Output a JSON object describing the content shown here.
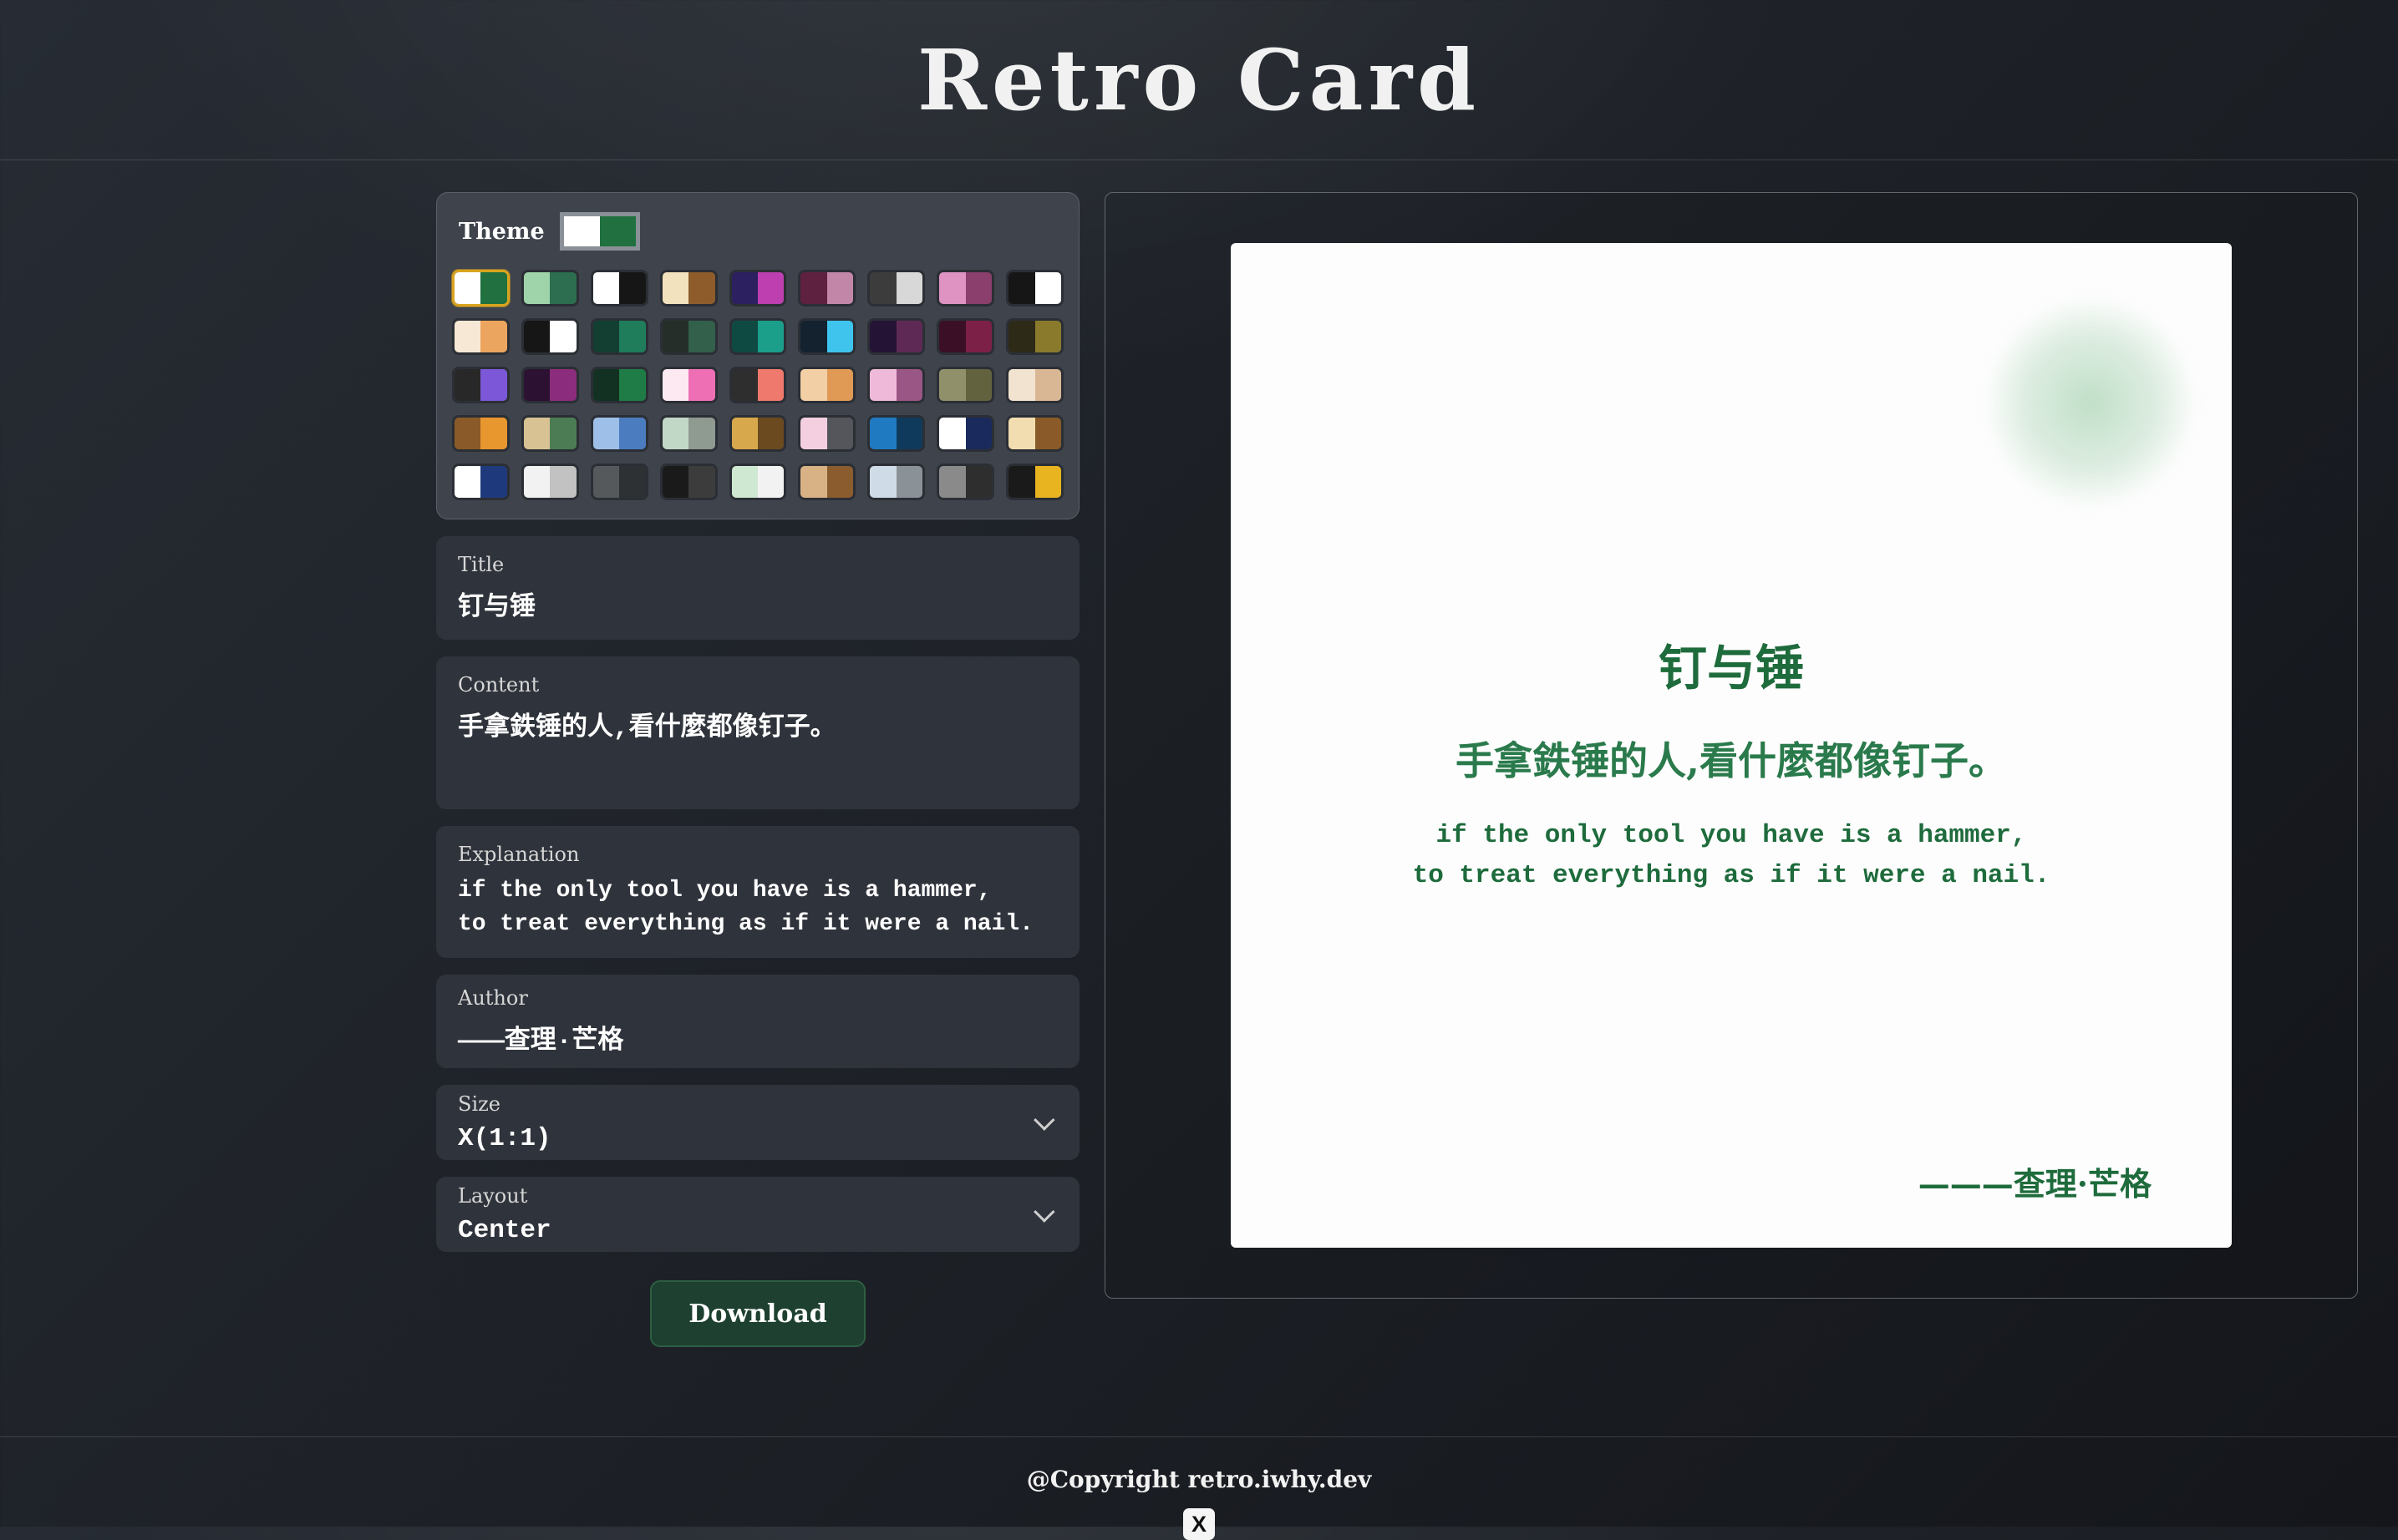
{
  "header": {
    "title": "Retro Card"
  },
  "colors": {
    "accent_selected": "#d9a41f",
    "button_green": "#1d4030",
    "preview_green": "#1e6b3c",
    "preview_green_light": "#2a7a4c",
    "blob_green": "#8dc59b",
    "card_bg": "#fdfdfd"
  },
  "theme": {
    "label": "Theme",
    "current": [
      "#ffffff",
      "#20713f"
    ],
    "selected_index": 0,
    "swatches": [
      [
        "#ffffff",
        "#20713f"
      ],
      [
        "#9fd4aa",
        "#2c6e4f"
      ],
      [
        "#ffffff",
        "#161616"
      ],
      [
        "#f2e2bd",
        "#8e5c2b"
      ],
      [
        "#2c2060",
        "#bd3fb0"
      ],
      [
        "#5f2140",
        "#c287a8"
      ],
      [
        "#3c3c3c",
        "#d8d8d8"
      ],
      [
        "#df93c3",
        "#8a3f6c"
      ],
      [
        "#161616",
        "#ffffff"
      ],
      [
        "#f6e8d4",
        "#eca55e"
      ],
      [
        "#161616",
        "#ffffff"
      ],
      [
        "#123f31",
        "#1f7d5c"
      ],
      [
        "#262e29",
        "#32604b"
      ],
      [
        "#0f4a42",
        "#1b9e8a"
      ],
      [
        "#13222e",
        "#3fc4ee"
      ],
      [
        "#251335",
        "#5e2a55"
      ],
      [
        "#3b1027",
        "#7d2048"
      ],
      [
        "#2e2a18",
        "#8a7a2c"
      ],
      [
        "#282828",
        "#7c57d8"
      ],
      [
        "#2c1132",
        "#8c2c7c"
      ],
      [
        "#123122",
        "#207c46"
      ],
      [
        "#fce9f2",
        "#ef6fb5"
      ],
      [
        "#2e2e2e",
        "#ef796c"
      ],
      [
        "#f2cfa5",
        "#e09a56"
      ],
      [
        "#efbad9",
        "#9a5685"
      ],
      [
        "#90906b",
        "#62623f"
      ],
      [
        "#f2e3d1",
        "#d9b694"
      ],
      [
        "#8a5a28",
        "#e8962e"
      ],
      [
        "#d8c294",
        "#4c7c54"
      ],
      [
        "#9ec0e8",
        "#4c7cc0"
      ],
      [
        "#c2d8c6",
        "#8f9a90"
      ],
      [
        "#d8a84c",
        "#6b4a1f"
      ],
      [
        "#f4cfe0",
        "#55565c"
      ],
      [
        "#1f7ac2",
        "#0f3a5c"
      ],
      [
        "#ffffff",
        "#1a2a5c"
      ],
      [
        "#f2ddb0",
        "#8a5a28"
      ],
      [
        "#ffffff",
        "#1f3a7c"
      ],
      [
        "#f2f2f2",
        "#c2c2c2"
      ],
      [
        "#55595c",
        "#2e3133"
      ],
      [
        "#1a1a1a",
        "#3c3c3c"
      ],
      [
        "#cfe8d2",
        "#f2f2f2"
      ],
      [
        "#d8b284",
        "#8a5c2e"
      ],
      [
        "#cfdce8",
        "#8a9298"
      ],
      [
        "#8a8a8a",
        "#2e2e2e"
      ],
      [
        "#1a1a1a",
        "#e8b41f"
      ]
    ]
  },
  "fields": {
    "title": {
      "label": "Title",
      "value": "钉与锤"
    },
    "content": {
      "label": "Content",
      "value": "手拿鉄锤的人,看什麼都像钉子。"
    },
    "explanation": {
      "label": "Explanation",
      "value": "if the only tool you have is a hammer,\n to treat everything as if it were a nail."
    },
    "author": {
      "label": "Author",
      "value": "———查理·芒格"
    }
  },
  "selects": {
    "size": {
      "label": "Size",
      "value": "X(1:1)"
    },
    "layout": {
      "label": "Layout",
      "value": "Center"
    }
  },
  "download_label": "Download",
  "preview": {
    "title": "钉与锤",
    "content": "手拿鉄锤的人,看什麼都像钉子。",
    "explanation": "if the only tool you have is a hammer,\nto treat everything as if it were a nail.",
    "author": "———查理·芒格"
  },
  "footer": {
    "copyright": "@Copyright retro.iwhy.dev",
    "x_glyph": "X"
  }
}
